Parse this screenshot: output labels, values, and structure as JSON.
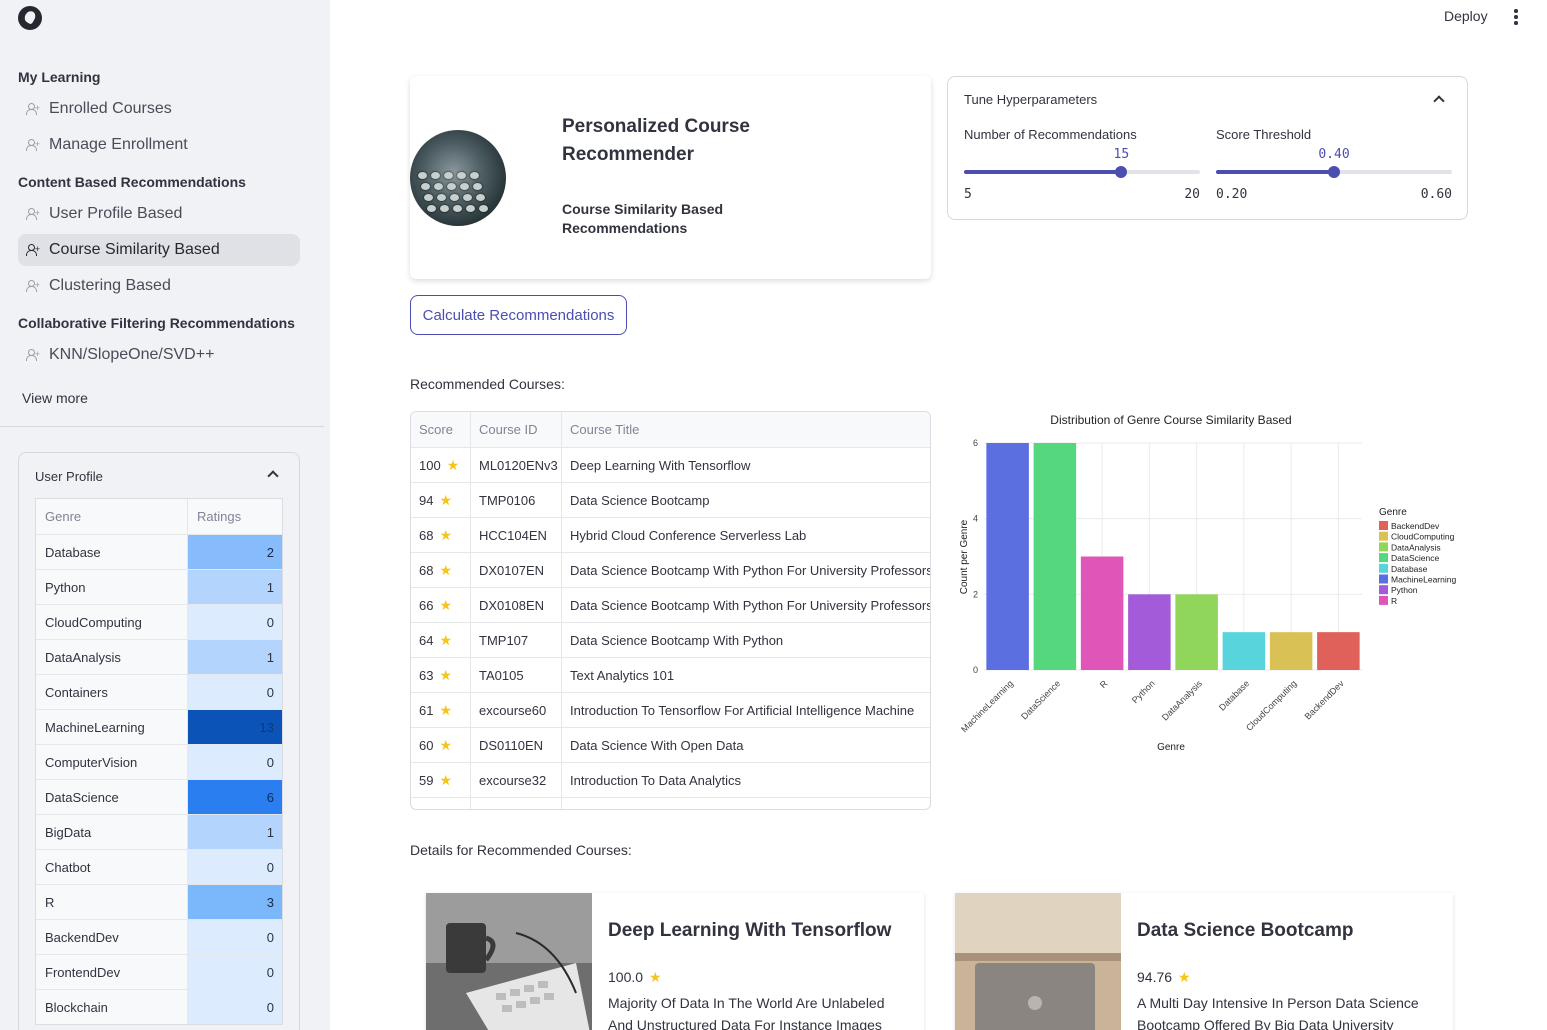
{
  "sidebar": {
    "sections": [
      {
        "header": "My Learning",
        "items": [
          "Enrolled Courses",
          "Manage Enrollment"
        ]
      },
      {
        "header": "Content Based Recommendations",
        "items": [
          "User Profile Based",
          "Course Similarity Based",
          "Clustering Based"
        ]
      },
      {
        "header": "Collaborative Filtering Recommendations",
        "items": [
          "KNN/SlopeOne/SVD++"
        ]
      }
    ],
    "active_item": "Course Similarity Based",
    "view_more": "View more",
    "profile": {
      "title": "User Profile",
      "columns": [
        "Genre",
        "Ratings"
      ],
      "rows": [
        {
          "genre": "Database",
          "rating": "2"
        },
        {
          "genre": "Python",
          "rating": "1"
        },
        {
          "genre": "CloudComputing",
          "rating": "0"
        },
        {
          "genre": "DataAnalysis",
          "rating": "1"
        },
        {
          "genre": "Containers",
          "rating": "0"
        },
        {
          "genre": "MachineLearning",
          "rating": "13"
        },
        {
          "genre": "ComputerVision",
          "rating": "0"
        },
        {
          "genre": "DataScience",
          "rating": "6"
        },
        {
          "genre": "BigData",
          "rating": "1"
        },
        {
          "genre": "Chatbot",
          "rating": "0"
        },
        {
          "genre": "R",
          "rating": "3"
        },
        {
          "genre": "BackendDev",
          "rating": "0"
        },
        {
          "genre": "FrontendDev",
          "rating": "0"
        },
        {
          "genre": "Blockchain",
          "rating": "0"
        }
      ]
    }
  },
  "topbar": {
    "deploy": "Deploy"
  },
  "header": {
    "title": "Personalized Course Recommender",
    "subtitle": "Course Similarity Based Recommendations"
  },
  "hyper": {
    "title": "Tune Hyperparameters",
    "num_rec": {
      "label": "Number of Recommendations",
      "value": "15",
      "min": "5",
      "max": "20",
      "value_num": 15,
      "min_num": 5,
      "max_num": 20
    },
    "threshold": {
      "label": "Score Threshold",
      "value": "0.40",
      "min": "0.20",
      "max": "0.60",
      "value_num": 0.4,
      "min_num": 0.2,
      "max_num": 0.6
    }
  },
  "calculate_label": "Calculate Recommendations",
  "recommended_label": "Recommended Courses:",
  "details_label": "Details for Recommended Courses:",
  "rec_table": {
    "columns": [
      "Score",
      "Course ID",
      "Course Title"
    ],
    "rows": [
      {
        "score": "100",
        "id": "ML0120ENv3",
        "title": "Deep Learning With Tensorflow"
      },
      {
        "score": "94",
        "id": "TMP0106",
        "title": "Data Science Bootcamp"
      },
      {
        "score": "68",
        "id": "HCC104EN",
        "title": "Hybrid Cloud Conference Serverless Lab"
      },
      {
        "score": "68",
        "id": "DX0107EN",
        "title": "Data Science Bootcamp With Python For University Professors"
      },
      {
        "score": "66",
        "id": "DX0108EN",
        "title": "Data Science Bootcamp With Python For University Professors"
      },
      {
        "score": "64",
        "id": "TMP107",
        "title": "Data Science Bootcamp With Python"
      },
      {
        "score": "63",
        "id": "TA0105",
        "title": "Text Analytics 101"
      },
      {
        "score": "61",
        "id": "excourse60",
        "title": "Introduction To Tensorflow For Artificial Intelligence  Machine"
      },
      {
        "score": "60",
        "id": "DS0110EN",
        "title": "Data Science With Open Data"
      },
      {
        "score": "59",
        "id": "excourse32",
        "title": "Introduction To Data Analytics"
      }
    ]
  },
  "chart_data": {
    "type": "bar",
    "title": "Distribution of Genre Course Similarity Based",
    "xlabel": "Genre",
    "ylabel": "Count per Genre",
    "categories": [
      "MachineLearning",
      "DataScience",
      "R",
      "Python",
      "DataAnalysis",
      "Database",
      "CloudComputing",
      "BackendDev"
    ],
    "values": [
      6,
      6,
      3,
      2,
      2,
      1,
      1,
      1
    ],
    "colors": [
      "#5b6fe0",
      "#55d87d",
      "#e056b8",
      "#a35bd9",
      "#8fd65a",
      "#58d4dc",
      "#d9c155",
      "#e0605a"
    ],
    "ylim": [
      0,
      6
    ],
    "yticks": [
      "0",
      "2",
      "4",
      "6"
    ],
    "grid": true,
    "legend": {
      "title": "Genre",
      "placement": "right",
      "entries": [
        {
          "name": "BackendDev",
          "color": "#e0605a"
        },
        {
          "name": "CloudComputing",
          "color": "#d9c155"
        },
        {
          "name": "DataAnalysis",
          "color": "#8fd65a"
        },
        {
          "name": "DataScience",
          "color": "#55d87d"
        },
        {
          "name": "Database",
          "color": "#58d4dc"
        },
        {
          "name": "MachineLearning",
          "color": "#5b6fe0"
        },
        {
          "name": "Python",
          "color": "#a35bd9"
        },
        {
          "name": "R",
          "color": "#e056b8"
        }
      ]
    }
  },
  "details": [
    {
      "title": "Deep Learning With Tensorflow",
      "score": "100.0",
      "desc": "Majority Of Data In The World Are Unlabeled And Unstructured Data For Instance Images"
    },
    {
      "title": "Data Science Bootcamp",
      "score": "94.76",
      "desc": "A Multi Day Intensive In Person Data Science Bootcamp Offered By Big Data University"
    }
  ]
}
